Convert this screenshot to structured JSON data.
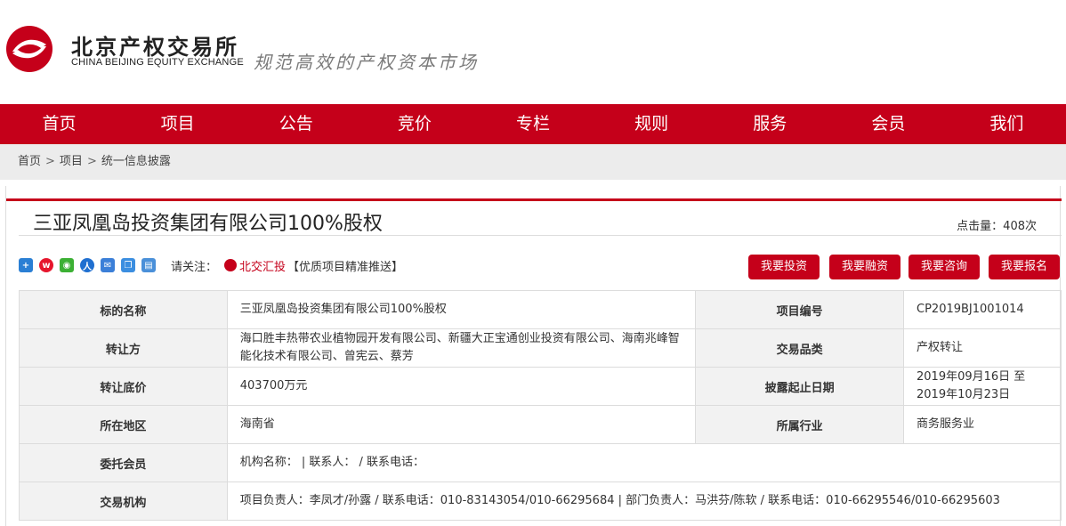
{
  "header": {
    "logo_cn": "北京产权交易所",
    "logo_en": "CHINA BEIJING EQUITY EXCHANGE",
    "slogan": "规范高效的产权资本市场"
  },
  "nav": [
    "首页",
    "项目",
    "公告",
    "竞价",
    "专栏",
    "规则",
    "服务",
    "会员",
    "我们"
  ],
  "breadcrumb": [
    "首页",
    "项目",
    "统一信息披露"
  ],
  "breadcrumb_sep": ">",
  "project": {
    "title": "三亚凤凰岛投资集团有限公司100%股权",
    "clicks": "点击量：408次"
  },
  "follow": {
    "label": "请关注：",
    "link": "北交汇投",
    "extra": "【优质项目精准推送】"
  },
  "buttons": [
    "我要投资",
    "我要融资",
    "我要咨询",
    "我要报名"
  ],
  "share_icons": [
    "plus-share-icon",
    "weibo-icon",
    "wechat-icon",
    "renren-icon",
    "email-icon",
    "copy-icon",
    "print-icon"
  ],
  "table": {
    "rows": [
      {
        "l1": "标的名称",
        "v1": "三亚凤凰岛投资集团有限公司100%股权",
        "l2": "项目编号",
        "v2": "CP2019BJ1001014"
      },
      {
        "l1": "转让方",
        "v1": "海口胜丰热带农业植物园开发有限公司、新疆大正宝通创业投资有限公司、海南兆峰智能化技术有限公司、曾宪云、蔡芳",
        "l2": "交易品类",
        "v2": "产权转让"
      },
      {
        "l1": "转让底价",
        "v1": "403700万元",
        "l2": "披露起止日期",
        "v2": "2019年09月16日 至 2019年10月23日"
      },
      {
        "l1": "所在地区",
        "v1": "海南省",
        "l2": "所属行业",
        "v2": "商务服务业"
      },
      {
        "l1": "委托会员",
        "v1": "机构名称： | 联系人： / 联系电话："
      },
      {
        "l1": "交易机构",
        "v1": "项目负责人：李凤才/孙露 / 联系电话：010-83143054/010-66295684 | 部门负责人：马洪芬/陈软 / 联系电话：010-66295546/010-66295603"
      }
    ]
  },
  "colors": {
    "brand": "#c5001a",
    "label_bg": "#f2f2f2"
  }
}
